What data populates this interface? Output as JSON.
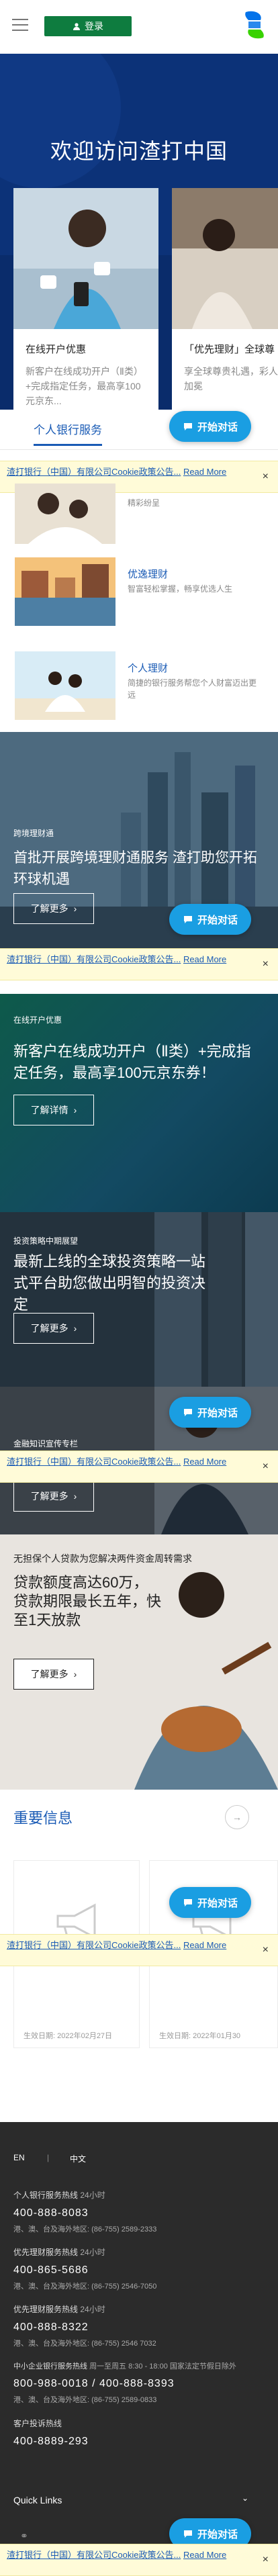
{
  "header": {
    "login_label": "登录"
  },
  "hero": {
    "title": "欢迎访问渣打中国",
    "cards": [
      {
        "title": "在线开户优惠",
        "desc": "新客户在线成功开户（Ⅱ类）+完成指定任务，最高享100元京东..."
      },
      {
        "title": "「优先理财」全球尊",
        "desc": "享全球尊贵礼遇，彩人生加冕"
      }
    ]
  },
  "tabs": {
    "active": "个人银行服务"
  },
  "chat": {
    "label": "开始对话"
  },
  "cookie": {
    "text": "渣打银行（中国）有限公司Cookie政策公告...",
    "more": "Read More",
    "close": "×"
  },
  "products": [
    {
      "title": "",
      "desc": "精彩纷呈"
    },
    {
      "title": "优逸理财",
      "desc": "智富轻松掌握，畅享优选人生"
    },
    {
      "title": "个人理财",
      "desc": "简捷的银行服务帮您个人财富迈出更远"
    }
  ],
  "banners": [
    {
      "tag": "跨境理财通",
      "title": "首批开展跨境理财通服务 渣打助您开拓环球机遇",
      "button": "了解更多"
    },
    {
      "tag": "在线开户优惠",
      "title": "新客户在线成功开户（Ⅱ类）+完成指定任务，最高享100元京东券！",
      "button": "了解详情"
    },
    {
      "tag": "投资策略中期展望",
      "title": "最新上线的全球投资策略一站式平台助您做出明智的投资决定",
      "button": "了解更多"
    },
    {
      "tag": "金融知识宣传专栏",
      "title": "",
      "button": "了解更多"
    },
    {
      "tag": "",
      "title": "无担保个人贷款为您解决两件资金周转需求",
      "subtitle": "贷款额度高达60万，贷款期限最长五年，快至1天放款",
      "button": "了解更多"
    }
  ],
  "info": {
    "title": "重要信息",
    "cards": [
      {
        "date": "生效日期: 2022年02月27日"
      },
      {
        "date": "生效日期: 2022年01月30"
      }
    ]
  },
  "footer": {
    "lang_en": "EN",
    "lang_zh": "中文",
    "hotlines": [
      {
        "name": "个人银行服务热线",
        "hours": "24小时",
        "phone": "400-888-8083",
        "sub": "港、澳、台及海外地区: (86-755) 2589-2333"
      },
      {
        "name": "优先理财服务热线",
        "hours": "24小时",
        "phone": "400-865-5686",
        "sub": "港、澳、台及海外地区: (86-755) 2546-7050"
      },
      {
        "name": "优先理财服务热线",
        "hours": "24小时",
        "phone": "400-888-8322",
        "sub": "港、澳、台及海外地区: (86-755) 2546 7032"
      },
      {
        "name": "中小企业银行服务热线",
        "hours": "周一至周五 8:30 - 18:00 国家法定节假日除外",
        "phone": "800-988-0018 / 400-888-8393",
        "sub": "港、澳、台及海外地区: (86-755) 2589-0833"
      },
      {
        "name": "客户投诉热线",
        "hours": "",
        "phone": "400-8889-293",
        "sub": ""
      }
    ],
    "quick_links": "Quick Links"
  },
  "colors": {
    "brand_green": "#0e7c3f",
    "brand_blue": "#1a5bb5",
    "chat_blue": "#1a9ee2",
    "cookie_bg": "#fffbd8"
  }
}
